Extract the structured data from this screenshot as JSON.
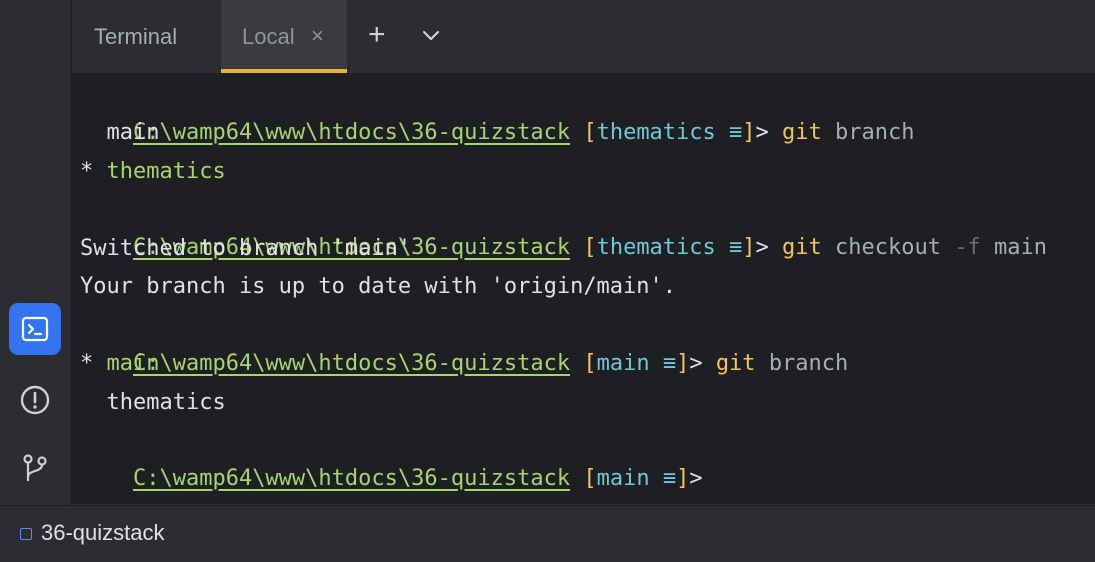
{
  "tabs": {
    "title": "Terminal",
    "active_tab": "Local",
    "close_glyph": "×",
    "add_glyph": "+"
  },
  "terminal": {
    "prompt_path": "C:\\wamp64\\www\\htdocs\\36-quizstack",
    "lines": [
      {
        "branch": "thematics",
        "cmd": "git",
        "args": "branch"
      },
      {
        "text": "  main"
      },
      {
        "text": "thematics",
        "star": "* "
      },
      {
        "branch": "thematics",
        "cmd": "git",
        "args": "checkout",
        "opt": "-f",
        "arg2": "main"
      },
      {
        "text": "Switched to branch 'main'"
      },
      {
        "text": "Your branch is up to date with 'origin/main'."
      },
      {
        "branch": "main",
        "cmd": "git",
        "args": "branch"
      },
      {
        "text": "main",
        "star": "* "
      },
      {
        "text": "  thematics"
      },
      {
        "branch": "main"
      }
    ],
    "status_glyph": "≡"
  },
  "statusbar": {
    "project": "36-quizstack"
  },
  "tool_icons": [
    "terminal-icon",
    "problems-icon",
    "git-icon"
  ],
  "colors": {
    "accent": "#3574f0",
    "path": "#a8d46f",
    "branch": "#6fc7d8",
    "command": "#f2c55c",
    "tab_underline": "#e8b23f"
  }
}
